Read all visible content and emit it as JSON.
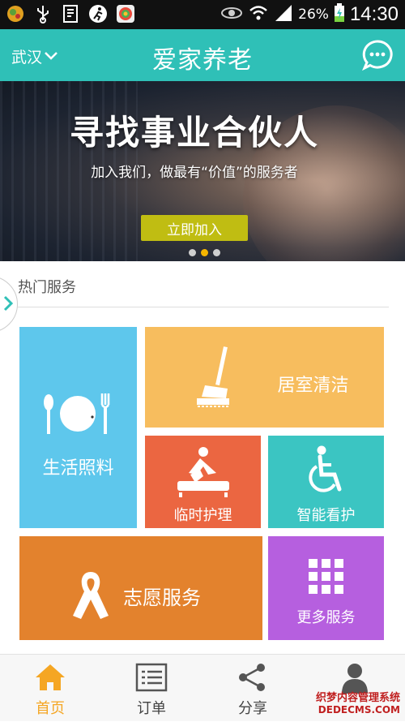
{
  "status_bar": {
    "battery_percent": "26%",
    "time": "14:30",
    "icons": [
      "app-icon",
      "usb-icon",
      "eye-reader-icon",
      "running-icon",
      "app-store-icon",
      "eye-icon",
      "wifi-icon",
      "signal-icon",
      "battery-icon"
    ]
  },
  "header": {
    "city": "武汉",
    "title": "爱家养老",
    "message_icon": "chat-bubble-icon"
  },
  "banner": {
    "title": "寻找事业合伙人",
    "subtitle": "加入我们，做最有“价值”的服务者",
    "button_label": "立即加入",
    "active_slide": 2,
    "slide_count": 3
  },
  "hot_services": {
    "title": "热门服务",
    "tiles": {
      "life_care": {
        "label": "生活照料",
        "icon": "plate-utensils-icon",
        "color": "#5ec7ec"
      },
      "house_clean": {
        "label": "居室清洁",
        "icon": "mop-icon",
        "color": "#f7bd5e"
      },
      "temp_care": {
        "label": "临时护理",
        "icon": "caregiver-icon",
        "color": "#eb6641"
      },
      "smart_watch": {
        "label": "智能看护",
        "icon": "wheelchair-icon",
        "color": "#3bc5c2"
      },
      "volunteer": {
        "label": "志愿服务",
        "icon": "ribbon-icon",
        "color": "#e3822d"
      },
      "more": {
        "label": "更多服务",
        "icon": "grid-icon",
        "color": "#b65fdf"
      }
    }
  },
  "bottom_nav": {
    "items": [
      {
        "label": "首页",
        "icon": "home-icon",
        "active": true
      },
      {
        "label": "订单",
        "icon": "order-list-icon",
        "active": false
      },
      {
        "label": "分享",
        "icon": "share-icon",
        "active": false
      },
      {
        "label": "",
        "icon": "user-icon",
        "active": false
      }
    ]
  },
  "watermark": {
    "line1": "织梦内容管理系统",
    "line2": "DEDECMS.COM"
  },
  "colors": {
    "accent": "#2fc0b7",
    "active_nav": "#f5a623",
    "banner_button": "#c0bd12"
  }
}
